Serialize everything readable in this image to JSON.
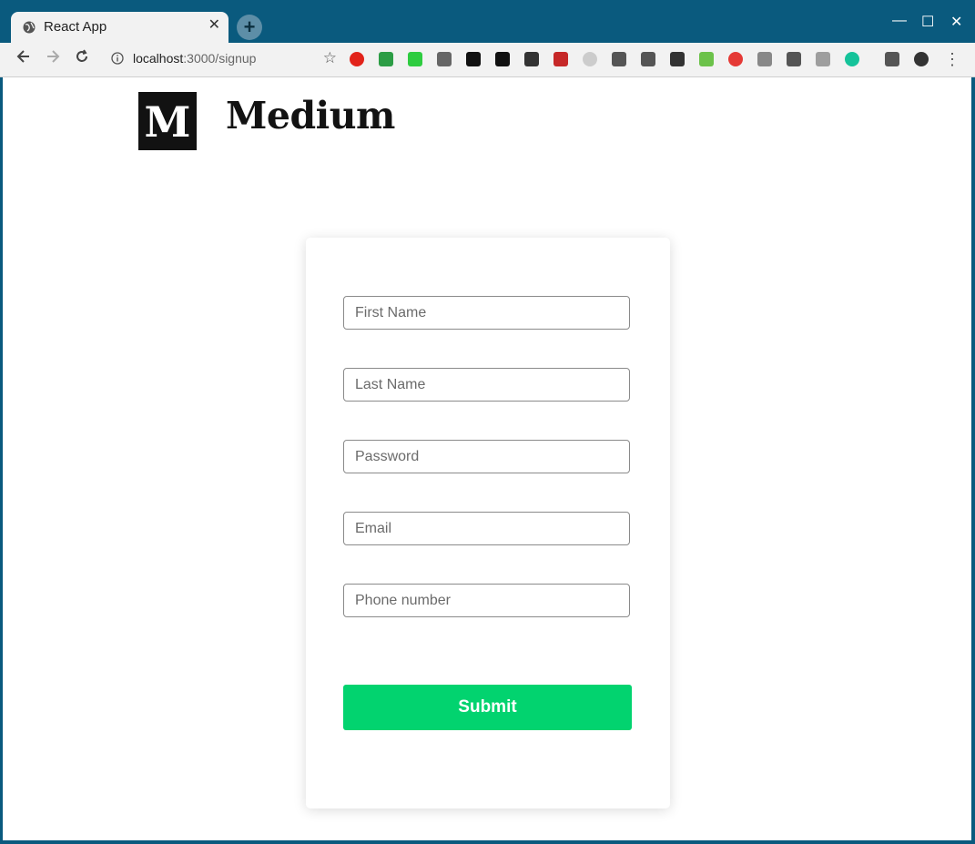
{
  "browser": {
    "tab_title": "React App",
    "tab_close": "✕",
    "new_tab": "+",
    "window_controls": {
      "minimize": "—",
      "maximize": "☐",
      "close": "✕"
    },
    "url_host": "localhost",
    "url_path": ":3000/signup",
    "menu": "⋮",
    "extensions": [
      {
        "name": "opera-icon",
        "color": "#e2231a"
      },
      {
        "name": "eyedropper-icon",
        "color": "#2c9d45"
      },
      {
        "name": "download-arrow-icon",
        "color": "#2ecc40"
      },
      {
        "name": "cloud-icon",
        "color": "#666666"
      },
      {
        "name": "gnome-icon",
        "color": "#111111"
      },
      {
        "name": "eye-icon",
        "color": "#111111"
      },
      {
        "name": "sneaker-icon",
        "color": "#333333"
      },
      {
        "name": "puzzle-red-icon",
        "color": "#c62828"
      },
      {
        "name": "clock-icon",
        "color": "#cccccc"
      },
      {
        "name": "windows-icon",
        "color": "#555555"
      },
      {
        "name": "s-square-icon",
        "color": "#555555"
      },
      {
        "name": "screenshot-icon",
        "color": "#333333"
      },
      {
        "name": "nodejs-icon",
        "color": "#6cc24a"
      },
      {
        "name": "swirl-icon",
        "color": "#e53935"
      },
      {
        "name": "drum-icon",
        "color": "#888888"
      },
      {
        "name": "pocket-icon",
        "color": "#555555"
      },
      {
        "name": "media-icon",
        "color": "#9e9e9e"
      },
      {
        "name": "grammarly-icon",
        "color": "#15c39a"
      },
      {
        "name": "key-icon",
        "color": "#555555"
      },
      {
        "name": "avatar-icon",
        "color": "#333333"
      }
    ]
  },
  "app": {
    "logo_letter": "M",
    "brand_name": "Medium",
    "form": {
      "first_name_placeholder": "First Name",
      "last_name_placeholder": "Last Name",
      "password_placeholder": "Password",
      "email_placeholder": "Email",
      "phone_placeholder": "Phone number",
      "submit_label": "Submit"
    },
    "colors": {
      "accent": "#02d36f",
      "chrome": "#0a5a7e"
    }
  }
}
